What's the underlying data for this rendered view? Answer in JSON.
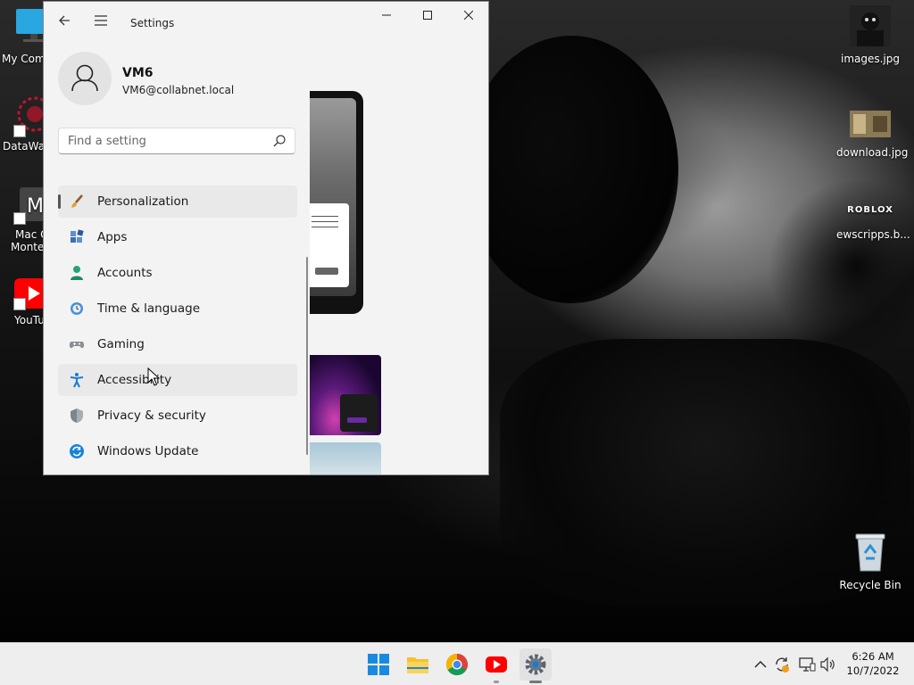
{
  "window": {
    "title": "Settings",
    "minimize_glyph": "—",
    "maximize_glyph": "☐",
    "close_glyph": "✕"
  },
  "profile": {
    "name": "VM6",
    "email": "VM6@collabnet.local"
  },
  "search": {
    "placeholder": "Find a setting",
    "value": ""
  },
  "nav": {
    "items": [
      {
        "label": "Personalization",
        "icon": "paintbrush-icon",
        "selected": true
      },
      {
        "label": "Apps",
        "icon": "apps-icon"
      },
      {
        "label": "Accounts",
        "icon": "accounts-icon"
      },
      {
        "label": "Time & language",
        "icon": "time-language-icon"
      },
      {
        "label": "Gaming",
        "icon": "gamepad-icon"
      },
      {
        "label": "Accessibility",
        "icon": "accessibility-icon"
      },
      {
        "label": "Privacy & security",
        "icon": "shield-icon"
      },
      {
        "label": "Windows Update",
        "icon": "windows-update-icon"
      }
    ]
  },
  "desktop": {
    "left_icons": [
      {
        "label": "My Com",
        "icon": "computer-icon"
      },
      {
        "label": "DataWag",
        "icon": "datawag-icon"
      },
      {
        "label": "Mac O",
        "label2": "Monte",
        "icon": "mac-os-icon"
      },
      {
        "label": "YouTu",
        "icon": "youtube-icon"
      }
    ],
    "right_icons": [
      {
        "label": "images.jpg",
        "icon": "image-file-icon"
      },
      {
        "label": "download.jpg",
        "icon": "image-file-icon"
      },
      {
        "label": "ewscripps.b...",
        "icon": "roblox-icon",
        "badge": "ROBLOX"
      },
      {
        "label": "Recycle Bin",
        "icon": "recycle-bin-icon"
      }
    ]
  },
  "taskbar": {
    "apps": [
      "windows-start-icon",
      "file-explorer-icon",
      "chrome-icon",
      "youtube-icon",
      "settings-icon"
    ],
    "clock": {
      "time": "6:26 AM",
      "date": "10/7/2022"
    }
  },
  "colors": {
    "window_bg": "#f3f3f3",
    "selected_bg": "#e9e9e9",
    "taskbar_bg": "#eeeeee",
    "accent": "#0067c0"
  }
}
